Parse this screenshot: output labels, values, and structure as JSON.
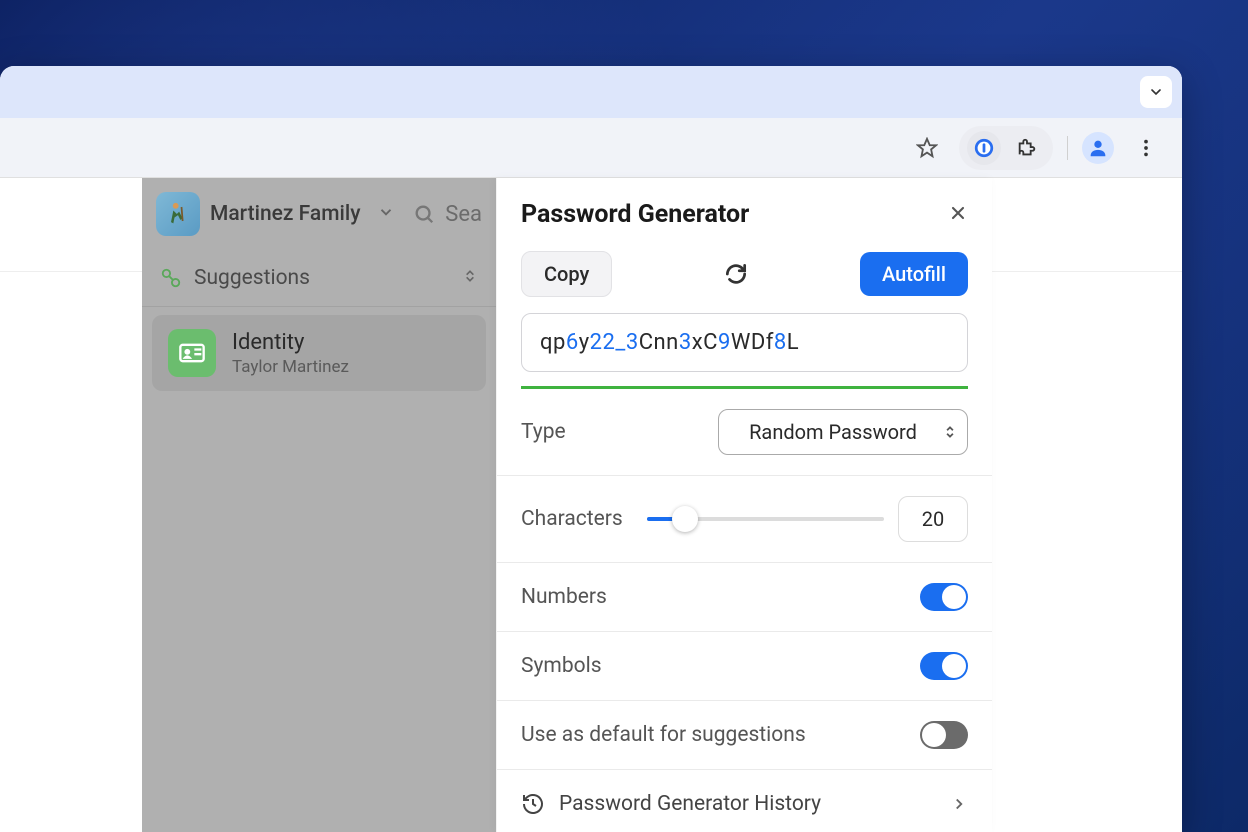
{
  "browser": {
    "tab_dropdown_icon": "chevron-down"
  },
  "sidebar": {
    "vault_name": "Martinez Family",
    "search_placeholder": "Sea",
    "suggestions_label": "Suggestions",
    "identity": {
      "title": "Identity",
      "subtitle": "Taylor Martinez"
    }
  },
  "popup": {
    "title": "Password Generator",
    "copy_label": "Copy",
    "autofill_label": "Autofill",
    "password_segments": [
      {
        "t": "qp",
        "c": "plain"
      },
      {
        "t": "6",
        "c": "digit"
      },
      {
        "t": "y",
        "c": "plain"
      },
      {
        "t": "22",
        "c": "digit"
      },
      {
        "t": "_",
        "c": "symbol"
      },
      {
        "t": "3",
        "c": "digit"
      },
      {
        "t": "Cnn",
        "c": "plain"
      },
      {
        "t": "3",
        "c": "digit"
      },
      {
        "t": "xC",
        "c": "plain"
      },
      {
        "t": "9",
        "c": "digit"
      },
      {
        "t": "WDf",
        "c": "plain"
      },
      {
        "t": "8",
        "c": "digit"
      },
      {
        "t": "L",
        "c": "plain"
      }
    ],
    "type_label": "Type",
    "type_value": "Random Password",
    "characters_label": "Characters",
    "characters_value": "20",
    "numbers_label": "Numbers",
    "numbers_on": true,
    "symbols_label": "Symbols",
    "symbols_on": true,
    "default_label": "Use as default for suggestions",
    "default_on": false,
    "history_label": "Password Generator History"
  }
}
